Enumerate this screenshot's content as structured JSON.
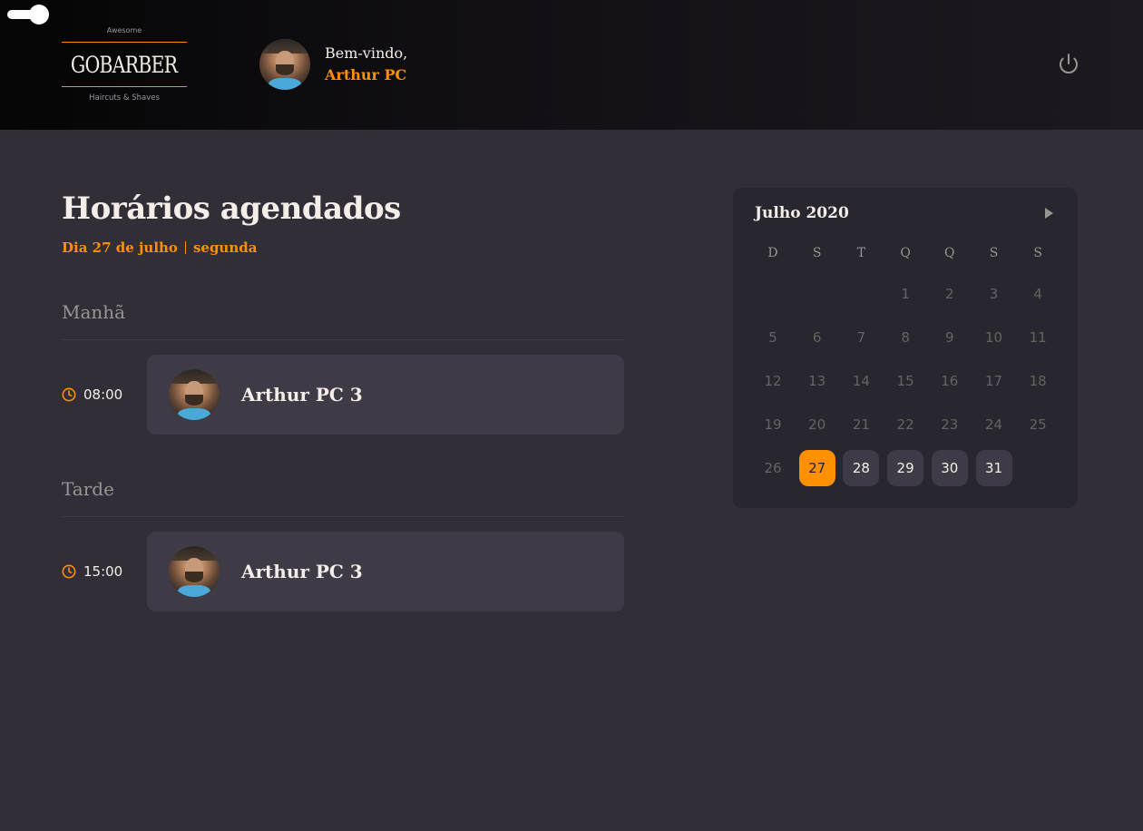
{
  "header": {
    "logo": {
      "top_text": "Awesome",
      "brand": "GOBARBER",
      "bottom_text": "Haircuts & Shaves"
    },
    "welcome_text": "Bem-vindo,",
    "user_name": "Arthur PC"
  },
  "main": {
    "title": "Horários agendados",
    "date_label": "Dia 27 de julho",
    "weekday_label": "segunda",
    "sections": [
      {
        "title": "Manhã",
        "appointments": [
          {
            "time": "08:00",
            "client": "Arthur PC 3"
          }
        ]
      },
      {
        "title": "Tarde",
        "appointments": [
          {
            "time": "15:00",
            "client": "Arthur PC 3"
          }
        ]
      }
    ]
  },
  "calendar": {
    "month_label": "Julho 2020",
    "weekdays": [
      "D",
      "S",
      "T",
      "Q",
      "Q",
      "S",
      "S"
    ],
    "first_weekday_index": 3,
    "days_in_month": 31,
    "selected_day": 27,
    "available_days": [
      28,
      29,
      30,
      31
    ]
  },
  "colors": {
    "accent": "#ff9000",
    "background": "#312e38",
    "card": "#3e3b47",
    "calendar_bg": "#28262e"
  },
  "icons": {
    "power": "power-icon",
    "clock": "clock-icon",
    "next": "chevron-right-icon"
  }
}
